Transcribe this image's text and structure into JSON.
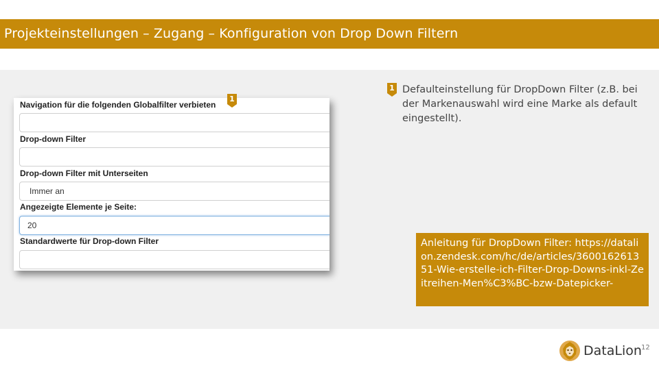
{
  "slide": {
    "title": "Projekteinstellungen – Zugang – Konfiguration von Drop Down Filtern",
    "page_number": "12"
  },
  "form": {
    "fields": [
      {
        "label": "Navigation für die folgenden Globalfilter verbieten",
        "value": ""
      },
      {
        "label": "Drop-down Filter",
        "value": ""
      },
      {
        "label": "Drop-down Filter mit Unterseiten",
        "value": "Immer an"
      },
      {
        "label": "Angezeigte Elemente je Seite:",
        "value": "20"
      },
      {
        "label": "Standardwerte für Drop-down Filter",
        "value": ""
      }
    ]
  },
  "markers": {
    "one": "1"
  },
  "note": {
    "text": "Defaulteinstellung für DropDown Filter (z.B. bei der Markenauswahl wird eine Marke als default eingestellt)."
  },
  "link_box": {
    "text": "Anleitung für DropDown Filter: https://datalion.zendesk.com/hc/de/articles/360016261351-Wie-erstelle-ich-Filter-Drop-Downs-inkl-Zeitreihen-Men%C3%BC-bzw-Datepicker-"
  },
  "logo": {
    "text": "DataLion",
    "icon": "lion-icon"
  },
  "colors": {
    "accent": "#c68a0a",
    "content_bg": "#f0f0f0",
    "focus_border": "#7fb1e0"
  }
}
